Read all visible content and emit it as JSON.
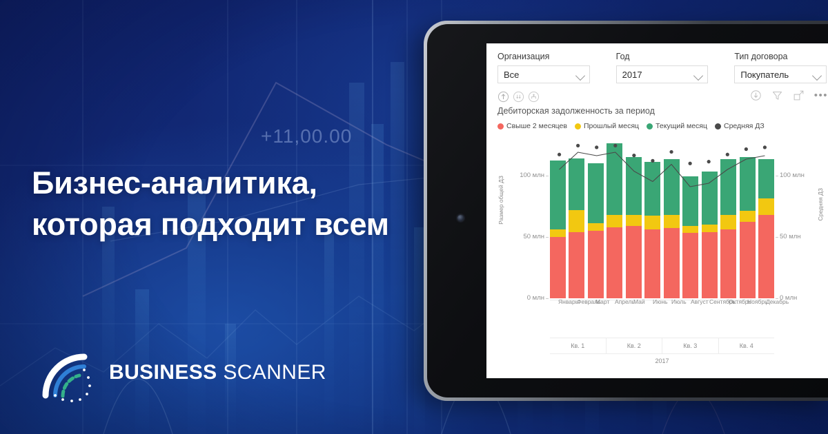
{
  "headline": {
    "line1": "Бизнес-аналитика,",
    "line2": "которая подходит всем"
  },
  "background": {
    "number_overlay": "+11,00.00"
  },
  "logo": {
    "name_bold": "BUSINESS",
    "name_light": " SCANNER"
  },
  "report": {
    "slicers": [
      {
        "label": "Организация",
        "value": "Все"
      },
      {
        "label": "Год",
        "value": "2017"
      },
      {
        "label": "Тип договора",
        "value": "Покупатель"
      }
    ],
    "toolbar_left": [
      "drill-up-icon",
      "drill-down-icon",
      "expand-hierarchy-icon"
    ],
    "toolbar_right": [
      "download-icon",
      "filter-icon",
      "focus-mode-icon",
      "more-options-icon"
    ],
    "more_label": "•••",
    "visual_title": "Дебиторская задолженность за период"
  },
  "chart_data": {
    "type": "bar",
    "title": "Дебиторская задолженность за период",
    "xlabel": "2017",
    "ylabel": "Размер общей ДЗ",
    "y2label": "Средняя ДЗ",
    "ylim": [
      0,
      130
    ],
    "y2lim": [
      0,
      130
    ],
    "yticks": [
      0,
      50,
      100
    ],
    "ytick_labels": [
      "0 млн",
      "50 млн",
      "100 млн"
    ],
    "y2tick_labels": [
      "0 млн",
      "50 млн",
      "100 млн"
    ],
    "grid": false,
    "legend_position": "top-left",
    "stacked": true,
    "categories": [
      "Январь",
      "Февраль",
      "Март",
      "Апрель",
      "Май",
      "Июнь",
      "Июль",
      "Август",
      "Сентябрь",
      "Октябрь",
      "Ноябрь",
      "Декабрь"
    ],
    "quarters": [
      "Кв. 1",
      "Кв. 2",
      "Кв. 3",
      "Кв. 4"
    ],
    "year": "2017",
    "series": [
      {
        "name": "Свыше 2 месяцев",
        "color": "#f4675f",
        "values": [
          50,
          54,
          55,
          58,
          59,
          56,
          57,
          53,
          54,
          56,
          62,
          68
        ]
      },
      {
        "name": "Прошлый месяц",
        "color": "#f2c811",
        "values": [
          6,
          18,
          6,
          10,
          9,
          11,
          11,
          6,
          6,
          12,
          9,
          13
        ]
      },
      {
        "name": "Текущий месяц",
        "color": "#3aa675",
        "values": [
          56,
          42,
          49,
          58,
          47,
          44,
          45,
          40,
          43,
          45,
          44,
          32
        ]
      }
    ],
    "line_series": {
      "name": "Средняя ДЗ",
      "color": "#4a4a4a",
      "values": [
        112,
        122,
        120,
        122,
        111,
        105,
        115,
        102,
        104,
        112,
        118,
        120
      ]
    }
  }
}
